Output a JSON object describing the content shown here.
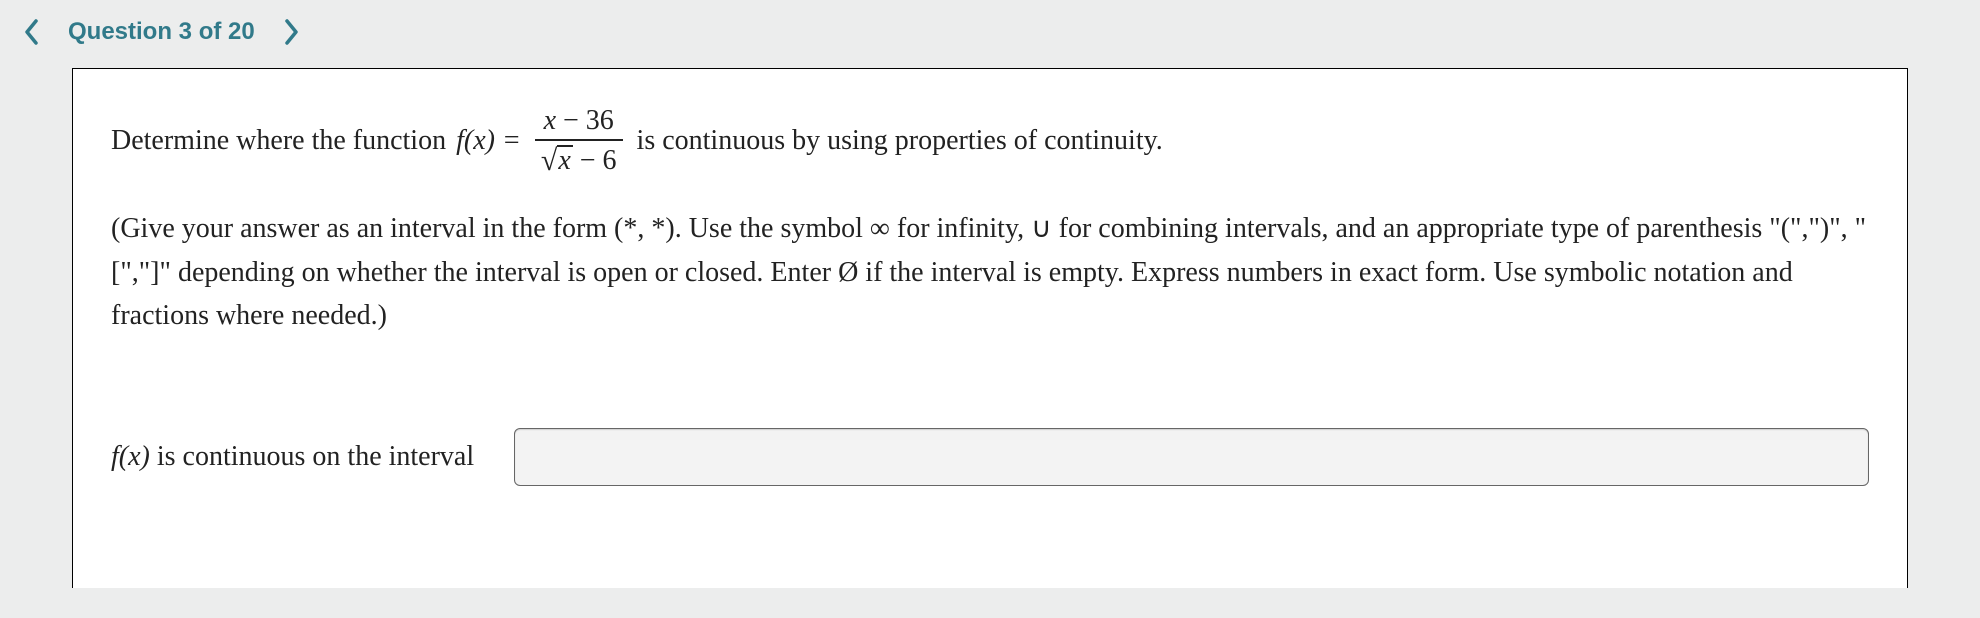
{
  "nav": {
    "title": "Question 3 of 20"
  },
  "question": {
    "lead": "Determine where the function",
    "fxeq": "f(x) =",
    "numerator_var": "x",
    "numerator_op": " − 36",
    "denom_surd_var": "x",
    "denom_tail": " − 6",
    "trail": "is continuous by using properties of continuity."
  },
  "instructions": "(Give your answer as an interval in the form (*, *). Use the symbol ∞ for infinity, ∪ for combining intervals, and an appropriate type of parenthesis \"(\",\")\", \"[\",\"]\" depending on whether the interval is open or closed. Enter Ø if the interval is empty. Express numbers in exact form. Use symbolic notation and fractions where needed.)",
  "answer": {
    "label_math": "f(x)",
    "label_rest": " is continuous on the interval",
    "value": ""
  }
}
